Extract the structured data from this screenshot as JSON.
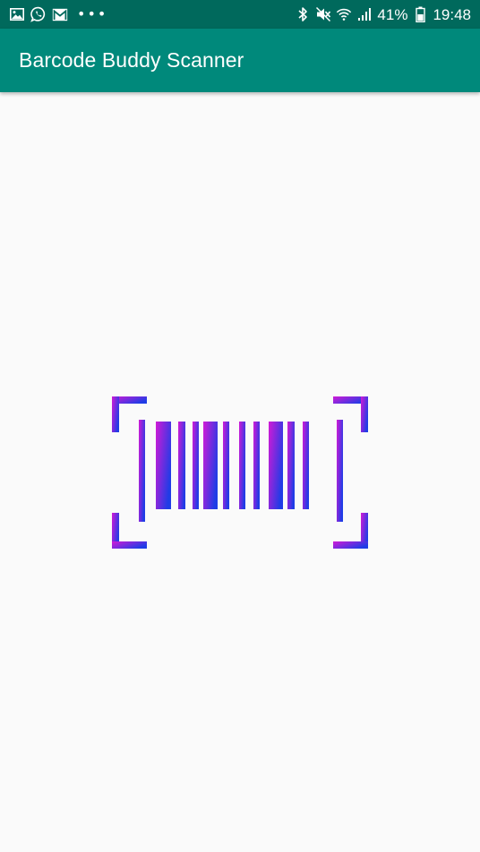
{
  "status_bar": {
    "icons_left": [
      "image-icon",
      "whatsapp-icon",
      "gmail-icon",
      "more-notifications-icon"
    ],
    "overflow_dots": "•••",
    "icons_right": [
      "bluetooth-icon",
      "mute-icon",
      "wifi-icon",
      "signal-icon"
    ],
    "battery": "41%",
    "time": "19:48",
    "background": "#00695c"
  },
  "app_bar": {
    "title": "Barcode Buddy Scanner",
    "background": "#00897b"
  },
  "logo": {
    "icon": "barcode-scanner-icon",
    "gradient_start": "#d21ad6",
    "gradient_end": "#1f3ce6"
  }
}
